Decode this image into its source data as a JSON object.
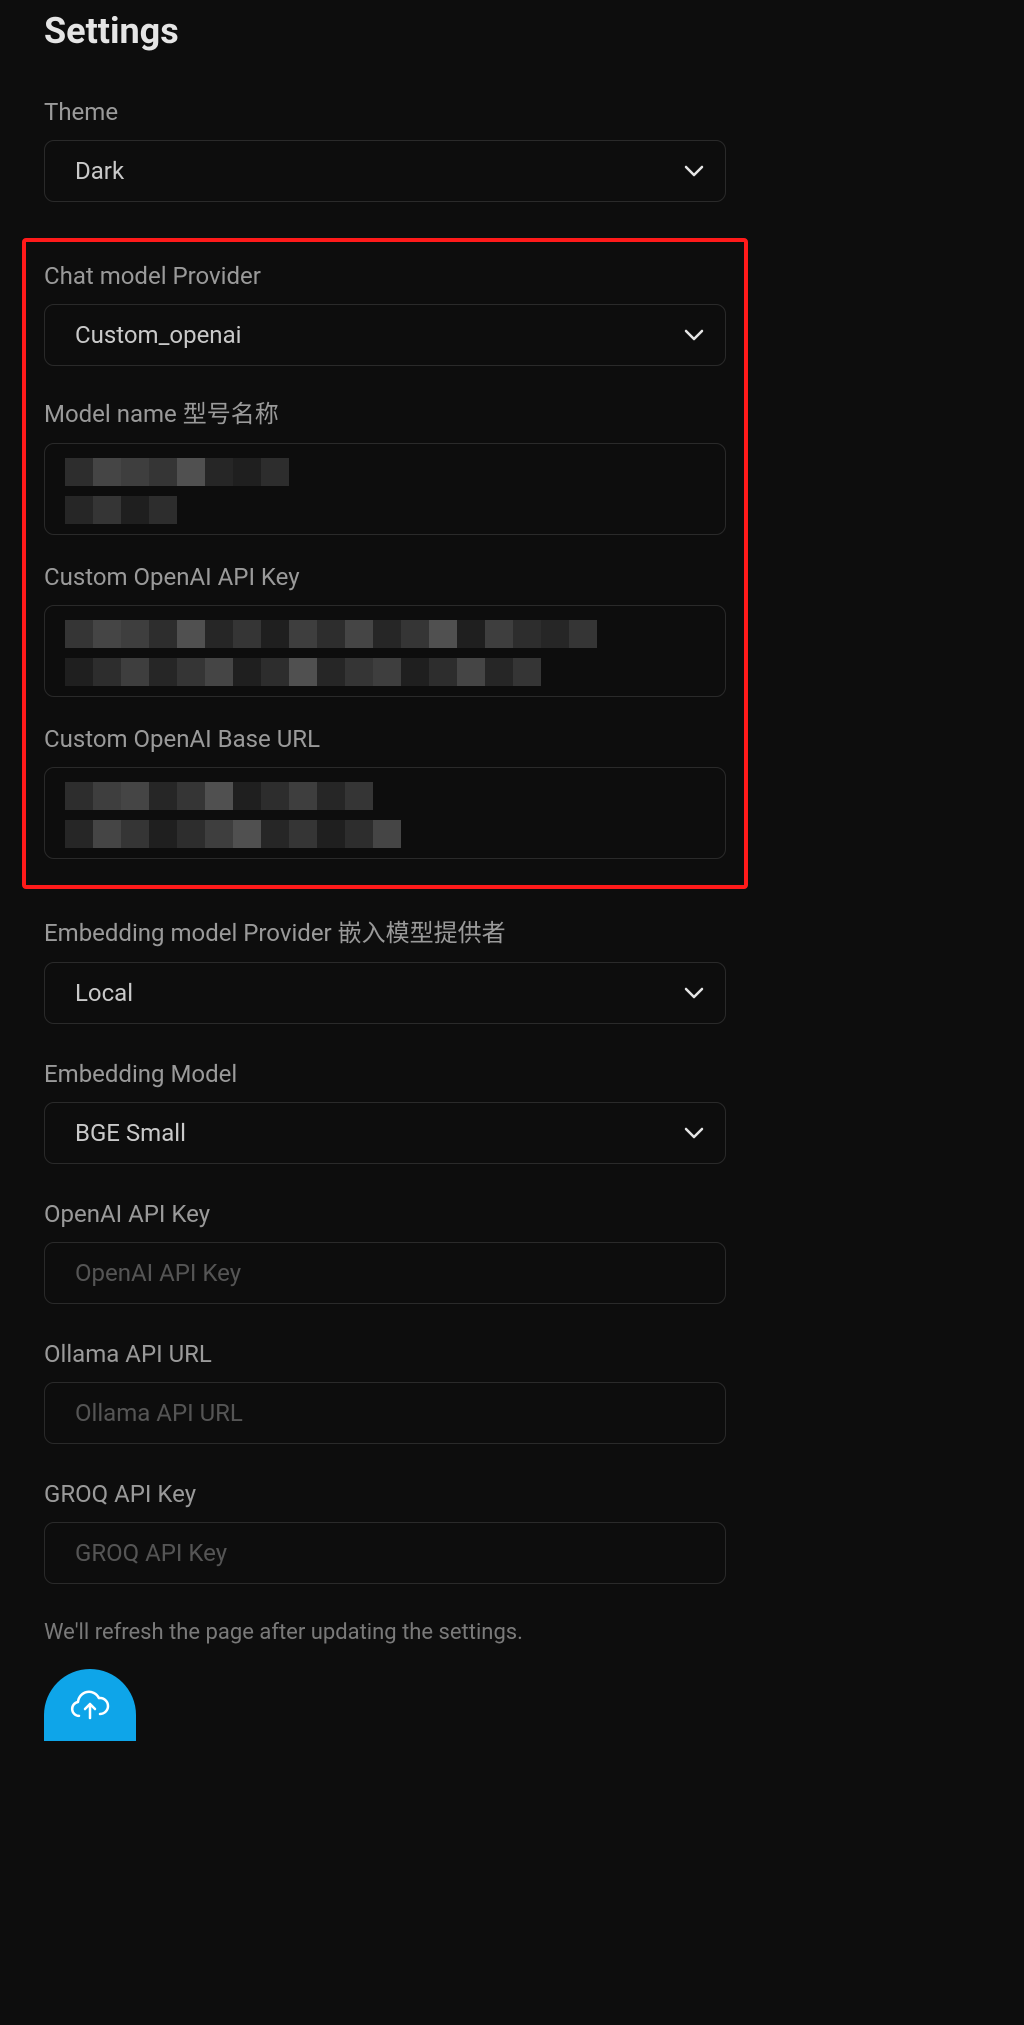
{
  "title": "Settings",
  "theme": {
    "label": "Theme",
    "value": "Dark"
  },
  "highlight": {
    "chat_provider": {
      "label": "Chat model Provider",
      "value": "Custom_openai"
    },
    "model_name": {
      "label": "Model name 型号名称",
      "redacted": true
    },
    "api_key": {
      "label": "Custom OpenAI API Key",
      "redacted": true
    },
    "base_url": {
      "label": "Custom OpenAI Base URL",
      "redacted": true
    }
  },
  "embedding_provider": {
    "label": "Embedding model Provider 嵌入模型提供者",
    "value": "Local"
  },
  "embedding_model": {
    "label": "Embedding Model",
    "value": "BGE Small"
  },
  "openai_key": {
    "label": "OpenAI API Key",
    "placeholder": "OpenAI API Key",
    "value": ""
  },
  "ollama_url": {
    "label": "Ollama API URL",
    "placeholder": "Ollama API URL",
    "value": ""
  },
  "groq_key": {
    "label": "GROQ API Key",
    "placeholder": "GROQ API Key",
    "value": ""
  },
  "footer_note": "We'll refresh the page after updating the settings.",
  "icons": {
    "chevron_down": "chevron-down-icon",
    "upload": "cloud-upload-icon"
  }
}
